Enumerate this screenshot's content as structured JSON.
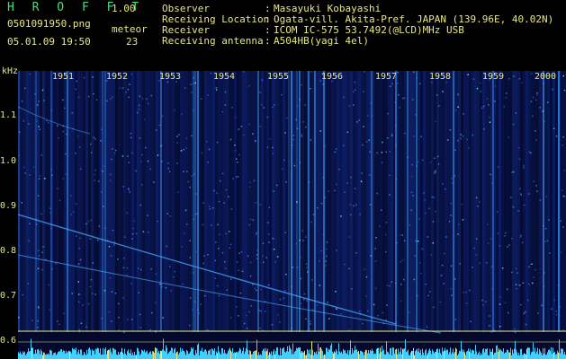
{
  "header": {
    "brand": "H R O F F T",
    "version": "1.00",
    "filename": "0501091950.png",
    "meteor_label": "meteor",
    "datetime": "05.01.09 19:50",
    "meteor_count": "23",
    "fields": [
      {
        "label": "Observer",
        "value": "Masayuki Kobayashi"
      },
      {
        "label": "Receiving Location",
        "value": "Ogata-vill. Akita-Pref. JAPAN (139.96E, 40.02N)"
      },
      {
        "label": "Receiver",
        "value": "ICOM IC-575 53.7492(@LCD)MHz USB"
      },
      {
        "label": "Receiving antenna",
        "value": "A504HB(yagi 4el)"
      }
    ]
  },
  "axis": {
    "y_unit": "kHz",
    "y_ticks": [
      "1.1",
      "1.0",
      "0.9",
      "0.8",
      "0.7",
      "0.6"
    ],
    "x_ticks": [
      "1951",
      "1952",
      "1953",
      "1954",
      "1955",
      "1956",
      "1957",
      "1958",
      "1959",
      "2000"
    ]
  },
  "colors": {
    "text": "#e8e880",
    "brand": "#3fe07a",
    "background": "#04082a",
    "signal": "#3aa0ff"
  }
}
